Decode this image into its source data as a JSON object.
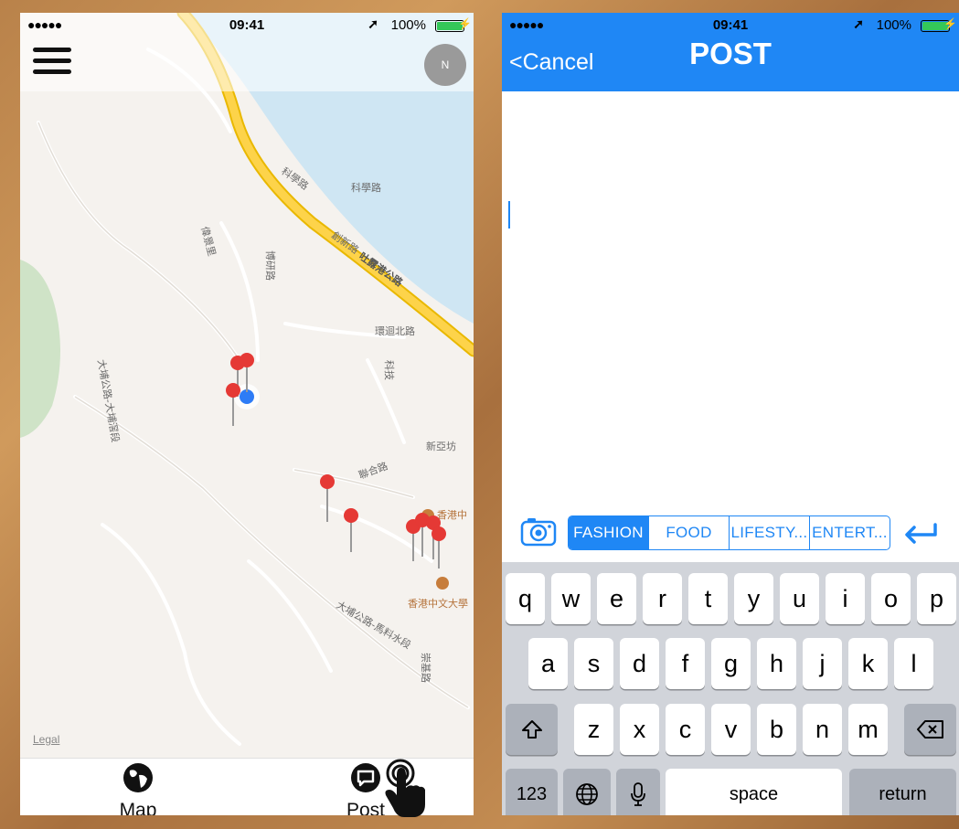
{
  "status_bar": {
    "signal": "●●●●●",
    "time": "09:41",
    "battery": "100%"
  },
  "map_screen": {
    "legal": "Legal",
    "compass_label": "N",
    "labels": [
      "科學路",
      "科學路",
      "創新路",
      "吐露港公路",
      "博研路",
      "偉景里",
      "環迴北路",
      "大埔公路-大埔滘段",
      "新亞坊",
      "聯合路",
      "香港中",
      "香港中文大學",
      "大埔公路-馬料水段",
      "崇基路",
      "科技"
    ],
    "tabs": {
      "map": "Map",
      "post": "Post"
    }
  },
  "post_screen": {
    "cancel": "<Cancel",
    "title": "POST",
    "categories": [
      "FASHION",
      "FOOD",
      "LIFESTY...",
      "ENTERT..."
    ],
    "selected_category": "FASHION"
  },
  "keyboard": {
    "row1": [
      "q",
      "w",
      "e",
      "r",
      "t",
      "y",
      "u",
      "i",
      "o",
      "p"
    ],
    "row2": [
      "a",
      "s",
      "d",
      "f",
      "g",
      "h",
      "j",
      "k",
      "l"
    ],
    "row3": [
      "z",
      "x",
      "c",
      "v",
      "b",
      "n",
      "m"
    ],
    "num": "123",
    "space": "space",
    "return": "return"
  },
  "colors": {
    "accent": "#1f87f5",
    "pin": "#e53935",
    "highway": "#fdd34a"
  }
}
